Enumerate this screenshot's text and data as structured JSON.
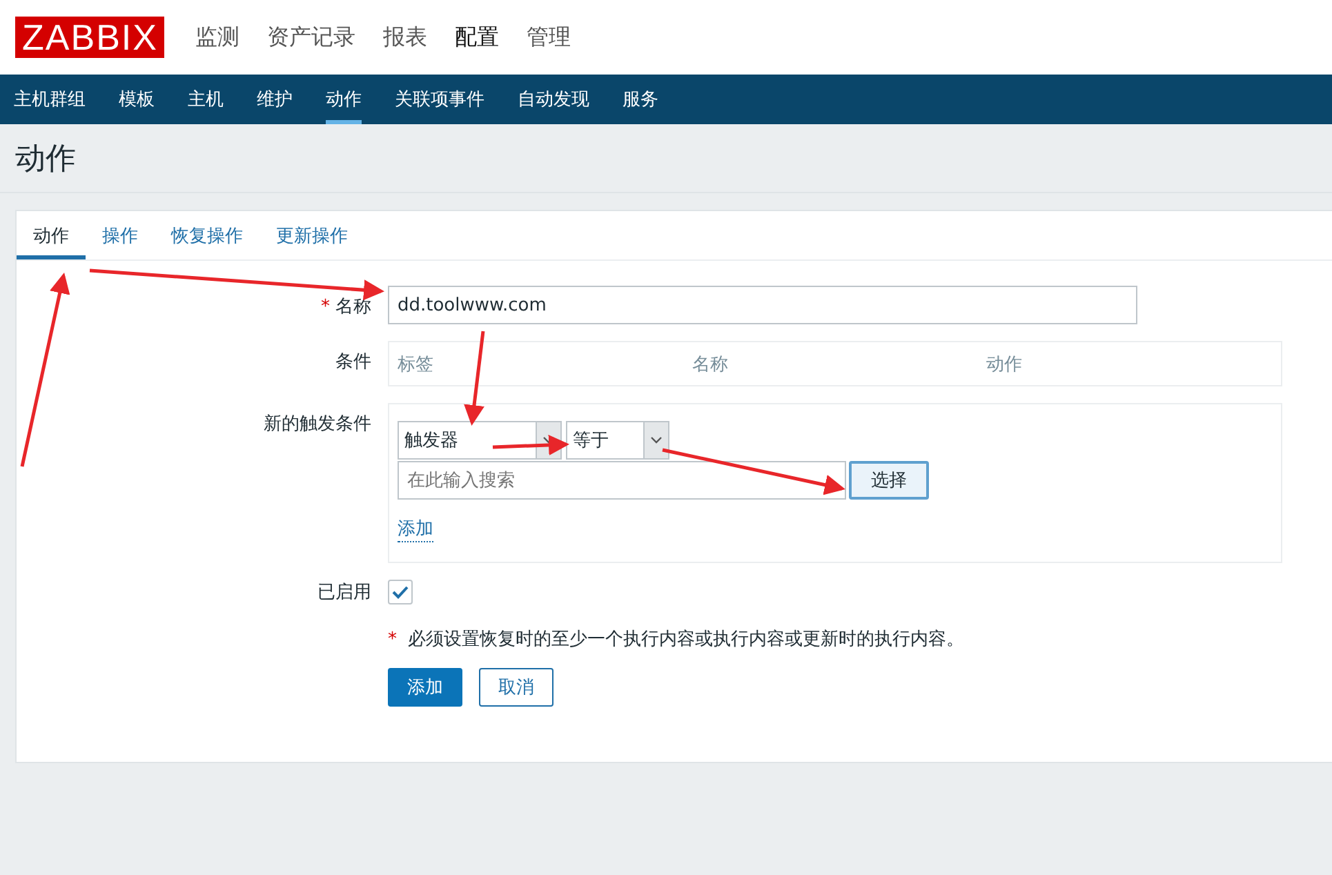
{
  "header": {
    "logo": "ZABBIX",
    "menu": [
      {
        "label": "监测",
        "selected": false
      },
      {
        "label": "资产记录",
        "selected": false
      },
      {
        "label": "报表",
        "selected": false
      },
      {
        "label": "配置",
        "selected": true
      },
      {
        "label": "管理",
        "selected": false
      }
    ]
  },
  "subnav": [
    {
      "label": "主机群组",
      "selected": false
    },
    {
      "label": "模板",
      "selected": false
    },
    {
      "label": "主机",
      "selected": false
    },
    {
      "label": "维护",
      "selected": false
    },
    {
      "label": "动作",
      "selected": true
    },
    {
      "label": "关联项事件",
      "selected": false
    },
    {
      "label": "自动发现",
      "selected": false
    },
    {
      "label": "服务",
      "selected": false
    }
  ],
  "page_title": "动作",
  "tabs": [
    {
      "label": "动作",
      "selected": true
    },
    {
      "label": "操作",
      "selected": false
    },
    {
      "label": "恢复操作",
      "selected": false
    },
    {
      "label": "更新操作",
      "selected": false
    }
  ],
  "form": {
    "name": {
      "required_mark": "*",
      "label": "名称",
      "value": "dd.toolwww.com"
    },
    "conditions": {
      "label": "条件",
      "columns": [
        "标签",
        "名称",
        "动作"
      ]
    },
    "new_condition": {
      "label": "新的触发条件",
      "type_select": "触发器",
      "operator_select": "等于",
      "search": {
        "placeholder": "在此输入搜索"
      },
      "select_button": "选择",
      "add_link": "添加"
    },
    "enabled": {
      "label": "已启用",
      "checked": true
    },
    "note": {
      "marker": "*",
      "text": "必须设置恢复时的至少一个执行内容或执行内容或更新时的执行内容。"
    },
    "buttons": [
      {
        "label": "添加",
        "kind": "primary"
      },
      {
        "label": "取消",
        "kind": "secondary"
      }
    ]
  }
}
